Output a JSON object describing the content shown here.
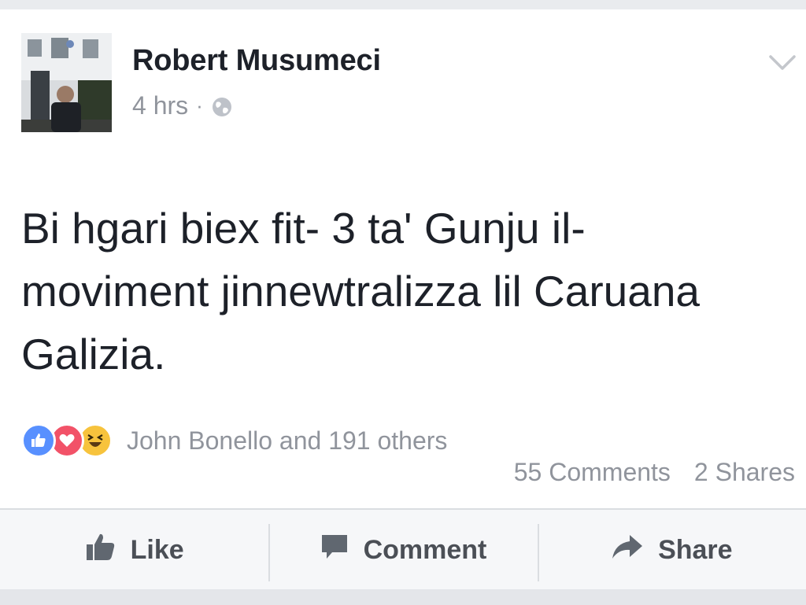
{
  "post": {
    "author": "Robert Musumeci",
    "time": "4 hrs",
    "separator": "·",
    "privacy_icon": "globe-icon",
    "options_icon": "chevron-down-icon",
    "text": "Bi hgari biex fit- 3 ta' Gunju il- moviment jinnewtralizza lil Caruana Galizia."
  },
  "reactions": {
    "icons": [
      "like-reaction-icon",
      "love-reaction-icon",
      "haha-reaction-icon"
    ],
    "summary": "John Bonello and 191 others",
    "comments": "55 Comments",
    "shares": "2 Shares"
  },
  "actions": {
    "like": "Like",
    "comment": "Comment",
    "share": "Share"
  },
  "colors": {
    "like_blue": "#5890ff",
    "love_red": "#f25268",
    "haha_yellow": "#f7c33d",
    "secondary_text": "#90949c"
  }
}
